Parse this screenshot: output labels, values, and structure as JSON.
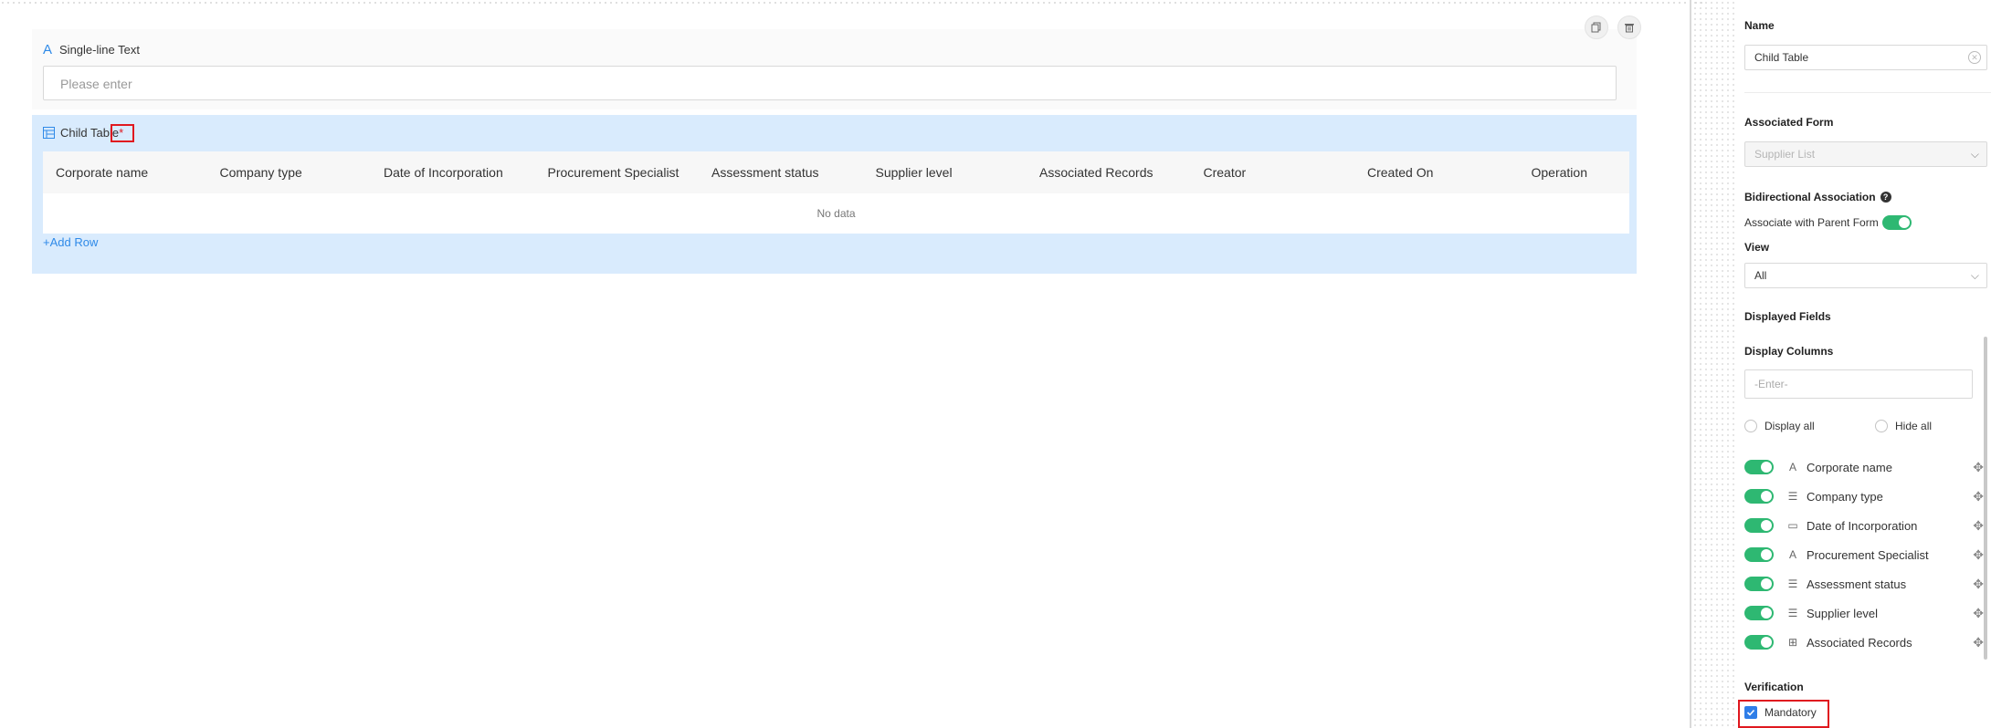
{
  "canvas": {
    "single_line_field": {
      "label": "Single-line Text",
      "placeholder": "Please enter"
    },
    "child_table": {
      "label": "Child Table",
      "required_marker": "*",
      "columns": [
        "Corporate name",
        "Company type",
        "Date of Incorporation",
        "Procurement Specialist",
        "Assessment status",
        "Supplier level",
        "Associated Records",
        "Creator",
        "Created On",
        "Operation"
      ],
      "empty_text": "No data",
      "add_row": "+Add Row"
    }
  },
  "panel": {
    "name_title": "Name",
    "name_value": "Child Table",
    "associated_form_title": "Associated Form",
    "associated_form_value": "Supplier List",
    "bidirectional_title": "Bidirectional Association",
    "associate_parent_label": "Associate with Parent Form",
    "view_title": "View",
    "view_value": "All",
    "displayed_fields_title": "Displayed Fields",
    "display_columns_title": "Display Columns",
    "display_columns_placeholder": "-Enter-",
    "display_all": "Display all",
    "hide_all": "Hide all",
    "columns": [
      {
        "label": "Corporate name",
        "icon": "text-icon",
        "enabled": true
      },
      {
        "label": "Company type",
        "icon": "list-icon",
        "enabled": true
      },
      {
        "label": "Date of Incorporation",
        "icon": "calendar-icon",
        "enabled": true
      },
      {
        "label": "Procurement Specialist",
        "icon": "text-icon",
        "enabled": true
      },
      {
        "label": "Assessment status",
        "icon": "list-icon",
        "enabled": true
      },
      {
        "label": "Supplier level",
        "icon": "list-icon",
        "enabled": true
      },
      {
        "label": "Associated Records",
        "icon": "association-icon",
        "enabled": true
      }
    ],
    "verification_title": "Verification",
    "mandatory_label": "Mandatory"
  },
  "colors": {
    "accent_blue": "#2f8ae8",
    "toggle_green": "#2eb872",
    "child_table_bg": "#d9ebfd",
    "highlight_red": "#e0181f"
  }
}
